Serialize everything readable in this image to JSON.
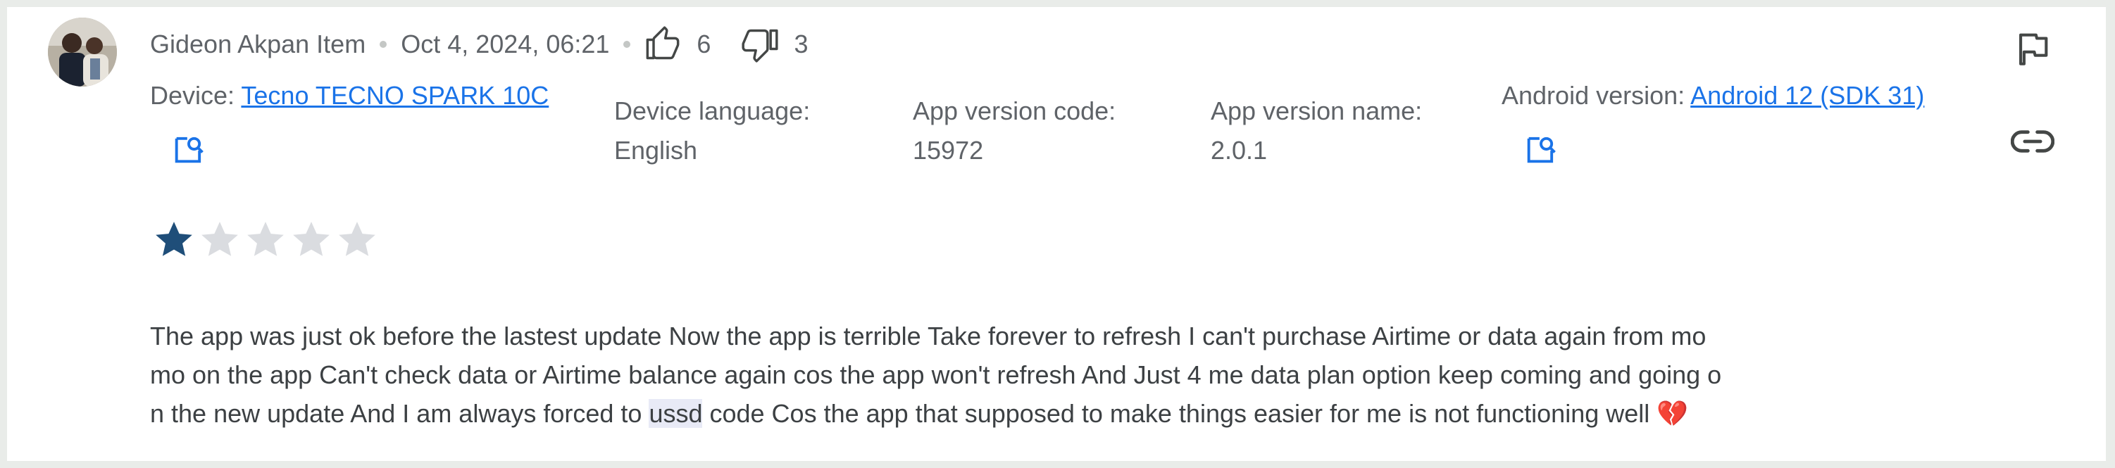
{
  "review": {
    "author": "Gideon Akpan Item",
    "date": "Oct 4, 2024, 06:21",
    "thumbs_up_count": "6",
    "thumbs_down_count": "3",
    "device_label": "Device:",
    "device_value": "Tecno TECNO SPARK 10C",
    "language_label": "Device language:",
    "language_value": "English",
    "version_code_label": "App version code:",
    "version_code_value": "15972",
    "version_name_label": "App version name:",
    "version_name_value": "2.0.1",
    "android_label": "Android version:",
    "android_value": "Android 12 (SDK 31)",
    "rating": 1,
    "rating_max": 5,
    "text_part1": "The app was just ok before the lastest update Now the app is terrible Take forever to refresh I can't purchase Airtime or data again from mo\nmo on the app Can't check data or Airtime balance again cos the app won't refresh And Just 4 me data plan option keep coming and going o\nn the new update And I am always forced to ",
    "text_highlight": "ussd",
    "text_part2": " code Cos the app that supposed to make things easier for me is not functioning well ",
    "text_emoji": "💔"
  },
  "colors": {
    "link": "#1a73e8",
    "star_filled": "#1f4e79",
    "star_empty": "#dadce0",
    "icon": "#444746"
  },
  "icons": [
    "thumbs-up-icon",
    "thumbs-down-icon",
    "flag-icon",
    "link-icon",
    "device-lookup-icon",
    "android-lookup-icon"
  ]
}
